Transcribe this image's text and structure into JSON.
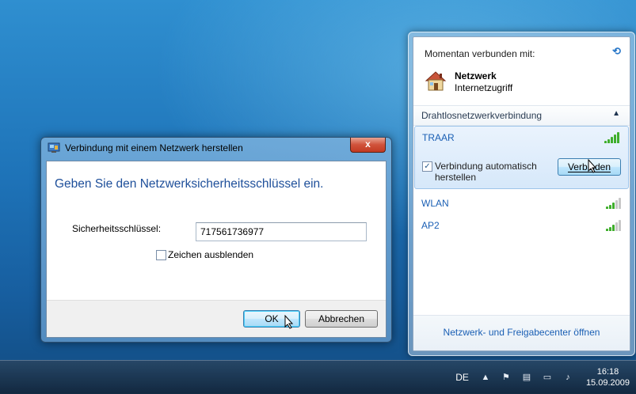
{
  "flyout": {
    "header": "Momentan verbunden mit:",
    "current_network": {
      "name": "Netzwerk",
      "status": "Internetzugriff"
    },
    "section_label": "Drahtlosnetzwerkverbindung",
    "networks": [
      {
        "name": "TRAAR",
        "signal_bars": 5
      },
      {
        "name": "WLAN",
        "signal_bars": 3
      },
      {
        "name": "AP2",
        "signal_bars": 3
      }
    ],
    "auto_connect_label": "Verbindung automatisch herstellen",
    "auto_connect_checked": true,
    "connect_button": "Verbinden",
    "footer_link": "Netzwerk- und Freigabecenter öffnen"
  },
  "dialog": {
    "title": "Verbindung mit einem Netzwerk herstellen",
    "close_label": "x",
    "heading": "Geben Sie den Netzwerksicherheitsschlüssel ein.",
    "key_label": "Sicherheitsschlüssel:",
    "key_value": "717561736977",
    "hide_chars_label": "Zeichen ausblenden",
    "hide_chars_checked": false,
    "ok_button": "OK",
    "cancel_button": "Abbrechen"
  },
  "taskbar": {
    "language": "DE",
    "time": "16:18",
    "date": "15.09.2009"
  },
  "colors": {
    "accent_blue": "#1a5fb4",
    "signal_green": "#3fae2c",
    "close_red": "#c23a22"
  }
}
